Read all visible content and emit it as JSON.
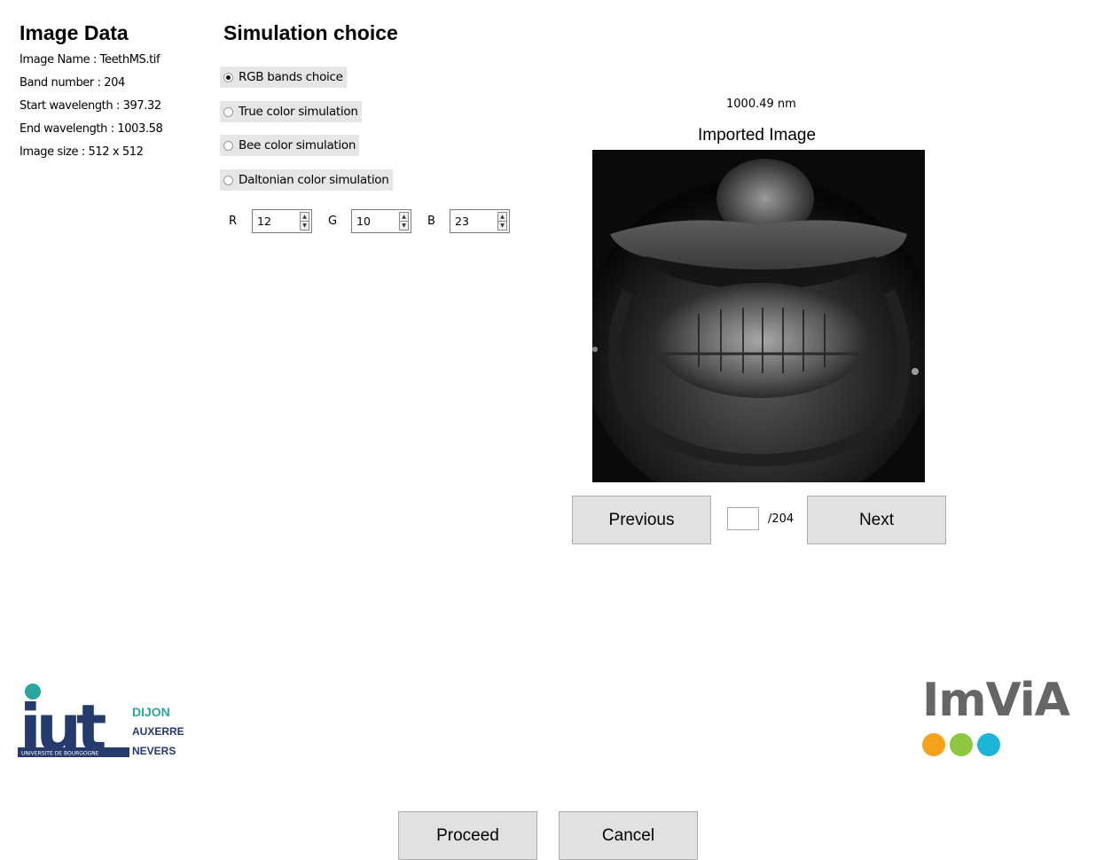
{
  "image_data": {
    "title": "Image Data",
    "name_line": "Image Name : TeethMS.tif",
    "band_line": "Band number : 204",
    "start_line": "Start wavelength : 397.32",
    "end_line": "End wavelength : 1003.58",
    "size_line": "Image size : 512 x 512"
  },
  "simulation": {
    "title": "Simulation choice",
    "options": [
      {
        "label": "RGB bands choice",
        "selected": true
      },
      {
        "label": "True color simulation",
        "selected": false
      },
      {
        "label": "Bee color simulation",
        "selected": false
      },
      {
        "label": "Daltonian color simulation",
        "selected": false
      }
    ],
    "rgb": {
      "r_label": "R",
      "r_value": "12",
      "g_label": "G",
      "g_value": "10",
      "b_label": "B",
      "b_value": "23"
    }
  },
  "viewer": {
    "wavelength": "1000.49 nm",
    "title": "Imported Image",
    "previous_label": "Previous",
    "next_label": "Next",
    "band_input_value": "",
    "band_total": "/204"
  },
  "logos": {
    "iut_main": "iut",
    "iut_line1": "DIJON",
    "iut_line2": "AUXERRE",
    "iut_line3": "NEVERS",
    "iut_sub": "UNIVERSITÉ DE BOURGOGNE",
    "imvia": "ImViA",
    "imvia_dot_colors": [
      "#f5a31a",
      "#8dc63f",
      "#1cb5d8"
    ],
    "iut_color": "#253a6d",
    "iut_dot_color": "#2aa6a0"
  },
  "actions": {
    "proceed_label": "Proceed",
    "cancel_label": "Cancel"
  }
}
